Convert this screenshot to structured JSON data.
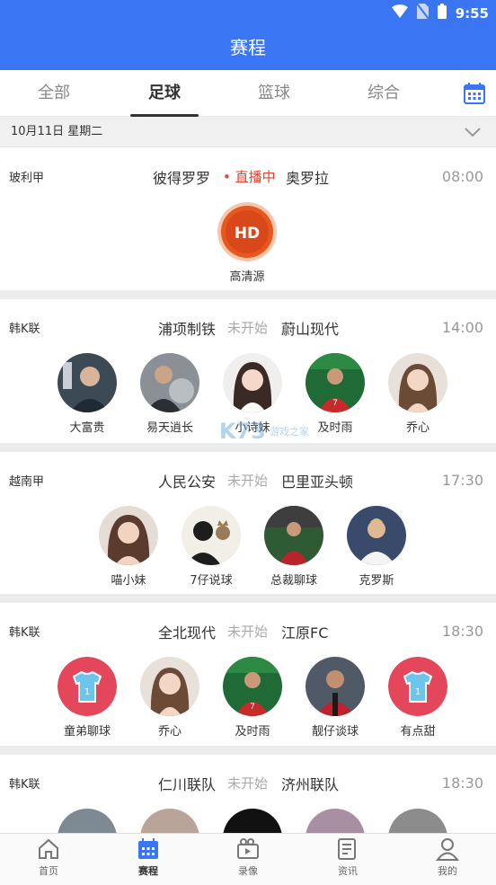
{
  "status_bar": {
    "time": "9:55"
  },
  "header": {
    "title": "赛程"
  },
  "tabs": [
    {
      "label": "全部"
    },
    {
      "label": "足球"
    },
    {
      "label": "篮球"
    },
    {
      "label": "综合"
    }
  ],
  "date_bar": {
    "date": "10月11日 星期二"
  },
  "matches": [
    {
      "league": "玻利甲",
      "home": "彼得罗罗",
      "status": "直播中",
      "away": "奥罗拉",
      "time": "08:00",
      "hd_badge": "HD",
      "sources": [
        "高清源"
      ]
    },
    {
      "league": "韩K联",
      "home": "浦项制铁",
      "status": "未开始",
      "away": "蔚山现代",
      "time": "14:00",
      "streamers": [
        "大富贵",
        "易天逍长",
        "小诗妹",
        "及时雨",
        "乔心"
      ]
    },
    {
      "league": "越南甲",
      "home": "人民公安",
      "status": "未开始",
      "away": "巴里亚头顿",
      "time": "17:30",
      "streamers": [
        "喵小妹",
        "7仔说球",
        "总裁聊球",
        "克罗斯"
      ]
    },
    {
      "league": "韩K联",
      "home": "全北现代",
      "status": "未开始",
      "away": "江原FC",
      "time": "18:30",
      "streamers": [
        "童弟聊球",
        "乔心",
        "及时雨",
        "靓仔谈球",
        "有点甜"
      ]
    },
    {
      "league": "韩K联",
      "home": "仁川联队",
      "status": "未开始",
      "away": "济州联队",
      "time": "18:30"
    }
  ],
  "bottom_nav": [
    {
      "label": "首页"
    },
    {
      "label": "赛程"
    },
    {
      "label": "录像"
    },
    {
      "label": "资讯"
    },
    {
      "label": "我的"
    }
  ],
  "watermark": {
    "text": "K73 游戏之家"
  },
  "colors": {
    "primary": "#3a75f4",
    "live": "#e8412f",
    "hd_badge": "#e8571e",
    "jersey_badge": "#e4475b"
  }
}
